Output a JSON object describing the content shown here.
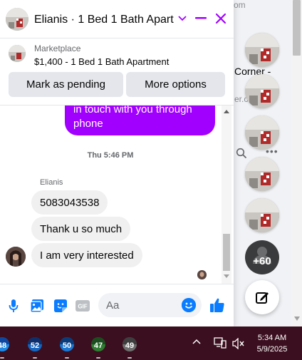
{
  "background": {
    "top_fragment": "...om",
    "listing_title_fragment": "Corner -",
    "sub_fragment": "er.c",
    "more_menu": "•••"
  },
  "chat": {
    "title": "Elianis · 1 Bed 1 Bath Apart...",
    "listing": {
      "source": "Marketplace",
      "summary": "$1,400 - 1 Bed 1 Bath Apartment",
      "mark_pending_label": "Mark as pending",
      "more_options_label": "More options"
    },
    "messages": {
      "outgoing": [
        "in touch with you through",
        "phone"
      ],
      "timestamp": "Thu 5:46 PM",
      "sender_name": "Elianis",
      "incoming": [
        "5083043538",
        "Thank u so much",
        "I am very interested"
      ]
    },
    "composer": {
      "placeholder": "Aa"
    },
    "accent_color": "#a100ff",
    "icon_color": "#0a7cff"
  },
  "chat_heads": {
    "more_count": "+60"
  },
  "taskbar": {
    "apps": [
      {
        "label": "48",
        "color": "#1e88e5"
      },
      {
        "label": "52",
        "color": "#1565c0"
      },
      {
        "label": "50",
        "color": "#1976d2"
      },
      {
        "label": "47",
        "color": "#2e7d32"
      },
      {
        "label": "49",
        "color": "#6d6d6d"
      }
    ],
    "time": "5:34 AM",
    "date": "5/9/2025"
  }
}
